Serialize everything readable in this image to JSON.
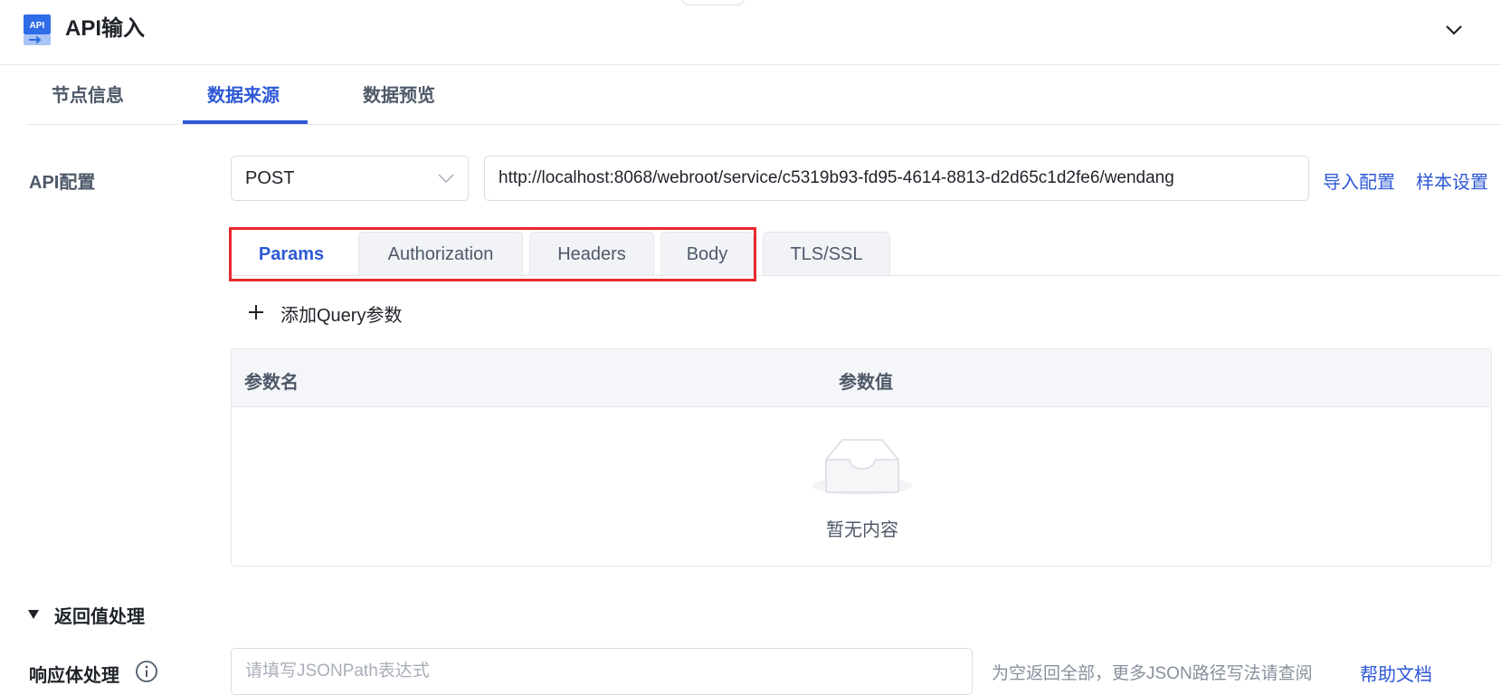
{
  "header": {
    "title": "API输入",
    "icon_text": "API",
    "collapse_icon": "chevron-down-icon"
  },
  "tabs": [
    {
      "label": "节点信息",
      "active": false
    },
    {
      "label": "数据来源",
      "active": true
    },
    {
      "label": "数据预览",
      "active": false
    }
  ],
  "api_config": {
    "label": "API配置",
    "method": "POST",
    "url": "http://localhost:8068/webroot/service/c5319b93-fd95-4614-8813-d2d65c1d2fe6/wendang",
    "import_link": "导入配置",
    "sample_link": "样本设置"
  },
  "subtabs": [
    {
      "label": "Params",
      "active": true
    },
    {
      "label": "Authorization",
      "active": false
    },
    {
      "label": "Headers",
      "active": false
    },
    {
      "label": "Body",
      "active": false
    },
    {
      "label": "TLS/SSL",
      "active": false
    }
  ],
  "params": {
    "add_label": "添加Query参数",
    "columns": [
      "参数名",
      "参数值"
    ],
    "empty_text": "暂无内容"
  },
  "return_section": {
    "title": "返回值处理",
    "response_label": "响应体处理",
    "input_placeholder": "请填写JSONPath表达式",
    "hint": "为空返回全部，更多JSON路径写法请查阅",
    "help_link": "帮助文档"
  },
  "colors": {
    "accent": "#2e58d6",
    "highlight": "#e8282e",
    "text": "#1f2329",
    "muted": "#4e5969"
  }
}
